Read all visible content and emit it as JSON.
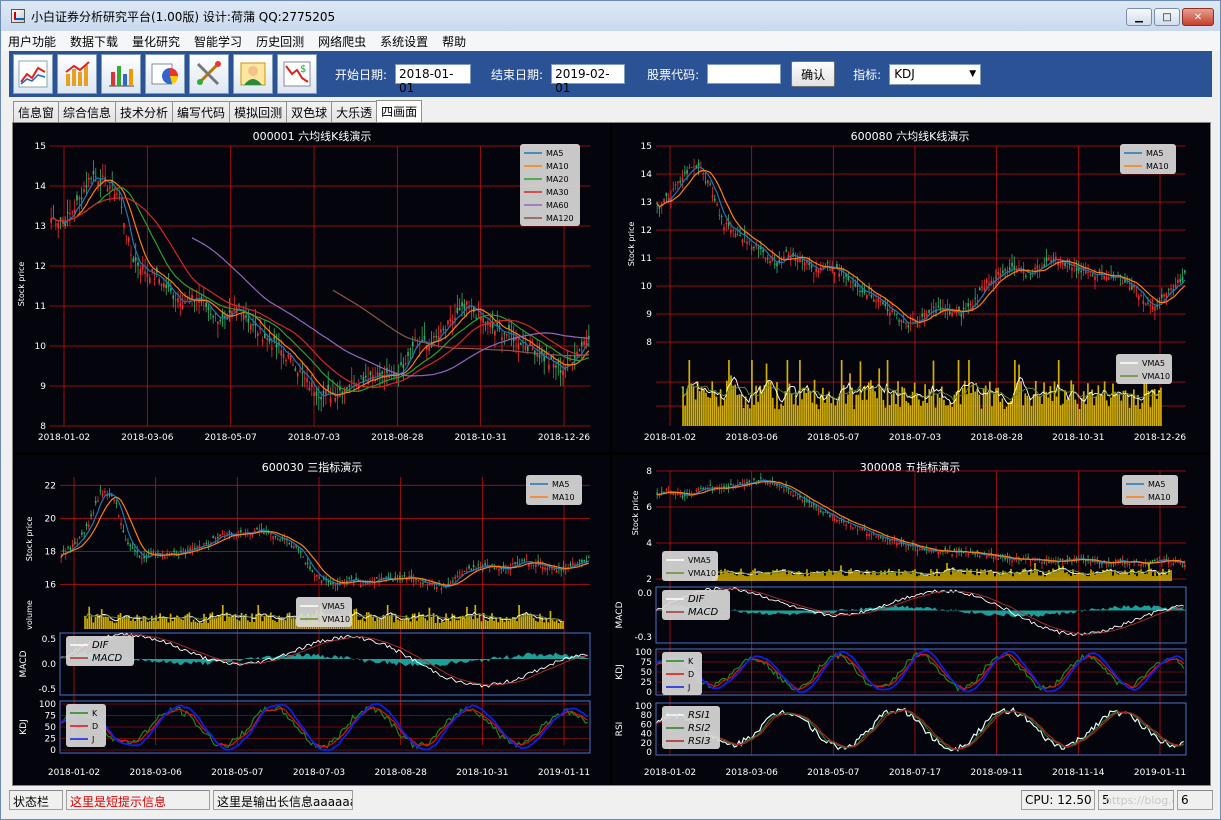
{
  "window": {
    "title": "小白证券分析研究平台(1.00版) 设计:荷蒲 QQ:2775205"
  },
  "menu": [
    "用户功能",
    "数据下载",
    "量化研究",
    "智能学习",
    "历史回测",
    "网络爬虫",
    "系统设置",
    "帮助"
  ],
  "toolbar": {
    "start_label": "开始日期:",
    "start_value": "2018-01-01",
    "end_label": "结束日期:",
    "end_value": "2019-02-01",
    "code_label": "股票代码:",
    "code_value": "",
    "confirm_label": "确认",
    "indicator_label": "指标:",
    "indicator_value": "KDJ"
  },
  "tabs": [
    "信息窗",
    "综合信息",
    "技术分析",
    "编写代码",
    "模拟回测",
    "双色球",
    "大乐透",
    "四画面"
  ],
  "active_tab": 7,
  "status": {
    "label": "状态栏",
    "short_info": "这里是短提示信息",
    "long_info": "这里是输出长信息aaaaaa",
    "cpu": "CPU: 12.50",
    "num1": "5",
    "watermark": "https://blog.csdn.net/hepu8",
    "num2": "6"
  },
  "colors": {
    "ma5": "#1f77b4",
    "ma10": "#ff7f0e",
    "ma20": "#2ca02c",
    "ma30": "#d62728",
    "ma60": "#9467bd",
    "ma120": "#8c564b",
    "grid": "#c01010",
    "volume": "#d4b000",
    "up": "#e83030",
    "down": "#2fb06a"
  },
  "chart_data": [
    {
      "type": "line",
      "title": "000001   六均线K线演示",
      "ylabel": "Stock price",
      "ylim": [
        8,
        15
      ],
      "yticks": [
        "8",
        "9",
        "10",
        "11",
        "12",
        "13",
        "14",
        "15"
      ],
      "xticks": [
        "2018-01-02",
        "2018-03-06",
        "2018-05-07",
        "2018-07-03",
        "2018-08-28",
        "2018-10-31",
        "2018-12-26"
      ],
      "legend": [
        "MA5",
        "MA10",
        "MA20",
        "MA30",
        "MA60",
        "MA120"
      ],
      "close": [
        13.2,
        13.1,
        13.6,
        14.3,
        14.1,
        13.8,
        12.2,
        11.9,
        11.7,
        11.3,
        11.1,
        11.2,
        10.8,
        10.6,
        11.0,
        10.5,
        10.2,
        9.9,
        9.6,
        9.1,
        8.8,
        8.8,
        9.0,
        9.2,
        9.3,
        9.2,
        9.4,
        10.2,
        10.0,
        10.3,
        10.7,
        11.0,
        10.7,
        10.4,
        10.3,
        10.1,
        9.9,
        9.6,
        9.4,
        9.8,
        10.3
      ]
    },
    {
      "type": "line",
      "title": "600080   六均线K线演示",
      "ylabel": "Stock price",
      "ylim": [
        8,
        15
      ],
      "yticks": [
        "8",
        "9",
        "10",
        "11",
        "12",
        "13",
        "14",
        "15"
      ],
      "xticks": [
        "2018-01-02",
        "2018-03-06",
        "2018-05-07",
        "2018-07-03",
        "2018-08-28",
        "2018-10-31",
        "2018-12-26"
      ],
      "legend": [
        "MA5",
        "MA10"
      ],
      "volume_legend": [
        "VMA5",
        "VMA10"
      ],
      "close": [
        12.8,
        13.2,
        14.0,
        14.3,
        13.6,
        12.2,
        11.9,
        11.6,
        11.2,
        10.8,
        11.2,
        11.0,
        10.5,
        10.7,
        10.4,
        10.0,
        9.8,
        9.4,
        9.0,
        8.6,
        8.8,
        9.2,
        9.1,
        9.0,
        9.4,
        10.2,
        10.4,
        10.6,
        10.4,
        10.7,
        11.0,
        10.8,
        10.6,
        10.5,
        10.4,
        10.3,
        10.0,
        9.5,
        9.3,
        9.9,
        10.4
      ]
    },
    {
      "type": "line",
      "title": "600030   三指标演示",
      "ylabel": "Stock price",
      "ylim": [
        15,
        22.5
      ],
      "yticks": [
        "16",
        "18",
        "20",
        "22"
      ],
      "xticks": [
        "2018-01-02",
        "2018-03-06",
        "2018-05-07",
        "2018-07-03",
        "2018-08-28",
        "2018-10-31",
        "2019-01-11"
      ],
      "legend": [
        "MA5",
        "MA10"
      ],
      "volume_label": "volume",
      "volume_legend": [
        "VMA5",
        "VMA10"
      ],
      "macd_label": "MACD",
      "macd_legend": [
        "DIF",
        "MACD"
      ],
      "macd_yticks": [
        "0.5",
        "0.0",
        "-0.5"
      ],
      "kdj_label": "KDJ",
      "kdj_legend": [
        "K",
        "D",
        "J"
      ],
      "kdj_yticks": [
        "100",
        "75",
        "50",
        "25",
        "0"
      ],
      "close": [
        17.8,
        18.4,
        19.5,
        21.6,
        21.3,
        18.4,
        17.6,
        17.9,
        17.8,
        17.9,
        18.3,
        18.4,
        18.9,
        19.0,
        19.2,
        19.3,
        19.0,
        18.6,
        18.1,
        16.8,
        16.2,
        16.1,
        16.3,
        16.0,
        16.4,
        16.2,
        16.5,
        16.2,
        16.0,
        15.8,
        16.5,
        16.9,
        17.2,
        17.0,
        17.1,
        17.4,
        17.3,
        17.0,
        16.9,
        17.3,
        17.6
      ]
    },
    {
      "type": "line",
      "title": "300008   五指标演示",
      "ylabel": "Stock price",
      "ylim": [
        2,
        8
      ],
      "yticks": [
        "2",
        "4",
        "6",
        "8"
      ],
      "xticks": [
        "2018-01-02",
        "2018-03-06",
        "2018-05-07",
        "2018-07-17",
        "2018-09-11",
        "2018-11-14",
        "2019-01-11"
      ],
      "legend": [
        "MA5",
        "MA10"
      ],
      "volume_legend": [
        "VMA5",
        "VMA10"
      ],
      "macd_label": "MACD",
      "macd_legend": [
        "DIF",
        "MACD"
      ],
      "macd_yticks": [
        "0.0",
        "-0.3"
      ],
      "kdj_label": "KDJ",
      "kdj_legend": [
        "K",
        "D",
        "J"
      ],
      "kdj_yticks": [
        "100",
        "75",
        "50",
        "25",
        "0"
      ],
      "rsi_label": "RSI",
      "rsi_legend": [
        "RSI1",
        "RSI2",
        "RSI3"
      ],
      "rsi_yticks": [
        "100",
        "80",
        "60",
        "40",
        "20",
        "0"
      ],
      "close": [
        6.8,
        6.9,
        6.6,
        6.9,
        7.1,
        7.0,
        7.2,
        7.4,
        7.5,
        7.3,
        6.9,
        6.4,
        6.0,
        5.6,
        5.2,
        4.9,
        4.6,
        4.3,
        4.1,
        3.9,
        3.7,
        3.6,
        3.5,
        3.5,
        3.4,
        3.3,
        3.2,
        3.1,
        3.1,
        3.0,
        3.0,
        3.0,
        3.1,
        3.0,
        2.9,
        3.0,
        2.9,
        2.9,
        3.1,
        3.0,
        2.8
      ]
    }
  ]
}
